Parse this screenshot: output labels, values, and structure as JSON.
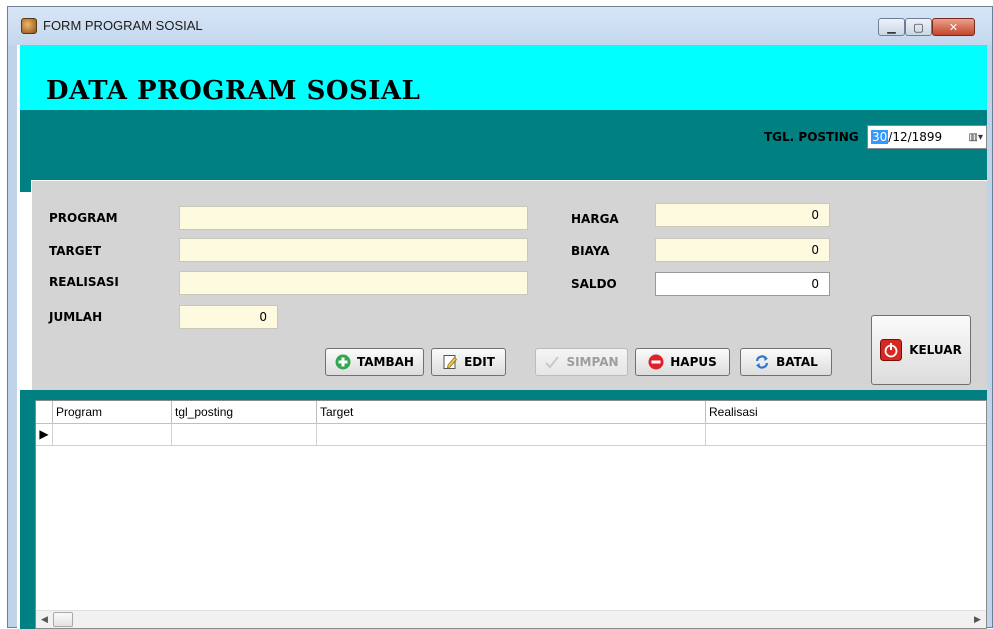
{
  "window": {
    "title": "FORM PROGRAM SOSIAL"
  },
  "banner": {
    "title": "DATA PROGRAM SOSIAL"
  },
  "tgl_posting": {
    "label": "TGL. POSTING",
    "day_selected": "30",
    "rest": "/12/1899",
    "dropdown_icon": "calendar-dropdown-icon"
  },
  "form": {
    "program_label": "PROGRAM",
    "program_value": "",
    "target_label": "TARGET",
    "target_value": "",
    "realisasi_label": "REALISASI",
    "realisasi_value": "",
    "jumlah_label": "JUMLAH",
    "jumlah_value": "0",
    "harga_label": "HARGA",
    "harga_value": "0",
    "biaya_label": "BIAYA",
    "biaya_value": "0",
    "saldo_label": "SALDO",
    "saldo_value": "0"
  },
  "buttons": {
    "tambah": "TAMBAH",
    "edit": "EDIT",
    "simpan": "SIMPAN",
    "hapus": "HAPUS",
    "batal": "BATAL",
    "keluar": "KELUAR"
  },
  "grid": {
    "columns": [
      "Program",
      "tgl_posting",
      "Target",
      "Realisasi"
    ],
    "rows": [
      [
        "",
        "",
        "",
        ""
      ]
    ]
  },
  "colors": {
    "banner": "#00ffff",
    "band": "#008080",
    "panel": "#d4d4d4",
    "field": "#fefae0"
  }
}
